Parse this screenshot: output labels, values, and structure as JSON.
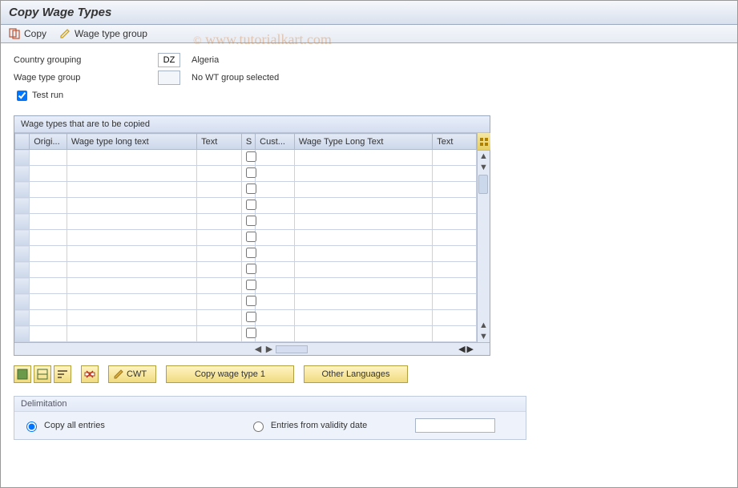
{
  "title": "Copy Wage Types",
  "toolbar": {
    "copy_label": "Copy",
    "wtgroup_label": "Wage type group"
  },
  "form": {
    "country_label": "Country grouping",
    "country_value": "DZ",
    "country_text": "Algeria",
    "wtgroup_label": "Wage type group",
    "wtgroup_value": "",
    "wtgroup_text": "No WT group selected",
    "testrun_label": "Test run",
    "testrun_checked": true
  },
  "grid": {
    "title": "Wage types that are to be copied",
    "columns": [
      "Origi...",
      "Wage type long text",
      "Text",
      "S",
      "Cust...",
      "Wage Type Long Text",
      "Text"
    ],
    "row_count": 12
  },
  "buttons": {
    "cwt": "CWT",
    "copy1": "Copy wage type 1",
    "other_lang": "Other Languages"
  },
  "delimitation": {
    "title": "Delimitation",
    "opt_all": "Copy all entries",
    "opt_from": "Entries from validity date",
    "selected": "all",
    "date": ""
  },
  "watermark": "www.tutorialkart.com"
}
